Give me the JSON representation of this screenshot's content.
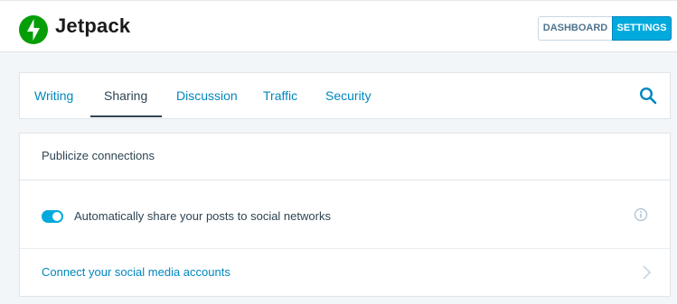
{
  "header": {
    "brand": "Jetpack",
    "logo_icon": "jetpack-bolt-icon",
    "nav": {
      "dashboard_label": "DASHBOARD",
      "settings_label": "SETTINGS",
      "active": "settings"
    }
  },
  "tabs": {
    "items": [
      {
        "label": "Writing"
      },
      {
        "label": "Sharing",
        "active": true
      },
      {
        "label": "Discussion"
      },
      {
        "label": "Traffic"
      },
      {
        "label": "Security"
      }
    ],
    "search_icon": "search-icon"
  },
  "publicize": {
    "title": "Publicize connections",
    "toggle": {
      "label": "Automatically share your posts to social networks",
      "checked": true
    },
    "info_icon": "info-icon",
    "connect_link": "Connect your social media accounts",
    "chevron_icon": "chevron-right-icon"
  },
  "colors": {
    "accent": "#00aadc",
    "link": "#0087be",
    "brand_green": "#069e08",
    "text": "#2e4453"
  }
}
